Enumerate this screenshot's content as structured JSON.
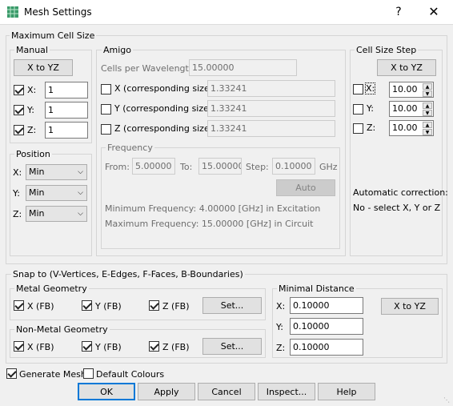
{
  "window": {
    "title": "Mesh Settings",
    "help": "?",
    "close": "✕"
  },
  "max_cell": {
    "legend": "Maximum Cell Size",
    "manual": {
      "legend": "Manual",
      "xtoyz": "X to YZ",
      "x_label": "X:",
      "x_value": "1",
      "y_label": "Y:",
      "y_value": "1",
      "z_label": "Z:",
      "z_value": "1"
    },
    "position": {
      "legend": "Position",
      "x_label": "X:",
      "x_value": "Min",
      "y_label": "Y:",
      "y_value": "Min",
      "z_label": "Z:",
      "z_value": "Min"
    },
    "amigo": {
      "legend": "Amigo",
      "cpw_label": "Cells per Wavelength:",
      "cpw_value": "15.00000",
      "x_label": "X (corresponding size)",
      "x_value": "1.33241",
      "y_label": "Y (corresponding size)",
      "y_value": "1.33241",
      "z_label": "Z (corresponding size)",
      "z_value": "1.33241",
      "frequency": {
        "legend": "Frequency",
        "from_label": "From:",
        "from_value": "5.00000",
        "to_label": "To:",
        "to_value": "15.00000",
        "step_label": "Step:",
        "step_value": "0.10000",
        "unit": "GHz",
        "auto": "Auto",
        "min_text": "Minimum Frequency: 4.00000 [GHz] in Excitation",
        "max_text": "Maximum Frequency: 15.00000 [GHz] in Circuit"
      }
    },
    "cell_step": {
      "legend": "Cell Size Step",
      "xtoyz": "X to YZ",
      "x_label": "X:",
      "x_value": "10.00",
      "y_label": "Y:",
      "y_value": "10.00",
      "z_label": "Z:",
      "z_value": "10.00",
      "auto_corr_label": "Automatic correction:",
      "auto_corr_text": "No - select X, Y or Z"
    }
  },
  "snap": {
    "legend": "Snap to (V-Vertices, E-Edges, F-Faces, B-Boundaries)",
    "metal": {
      "legend": "Metal Geometry",
      "x": "X (FB)",
      "y": "Y (FB)",
      "z": "Z (FB)",
      "set": "Set..."
    },
    "nonmetal": {
      "legend": "Non-Metal Geometry",
      "x": "X (FB)",
      "y": "Y (FB)",
      "z": "Z (FB)",
      "set": "Set..."
    },
    "mindist": {
      "legend": "Minimal Distance",
      "x_label": "X:",
      "x_value": "0.10000",
      "y_label": "Y:",
      "y_value": "0.10000",
      "z_label": "Z:",
      "z_value": "0.10000",
      "xtoyz": "X to YZ"
    }
  },
  "footer": {
    "generate_mesh": "Generate Mesh",
    "default_colours": "Default Colours",
    "ok": "OK",
    "apply": "Apply",
    "cancel": "Cancel",
    "inspect": "Inspect...",
    "help": "Help"
  }
}
